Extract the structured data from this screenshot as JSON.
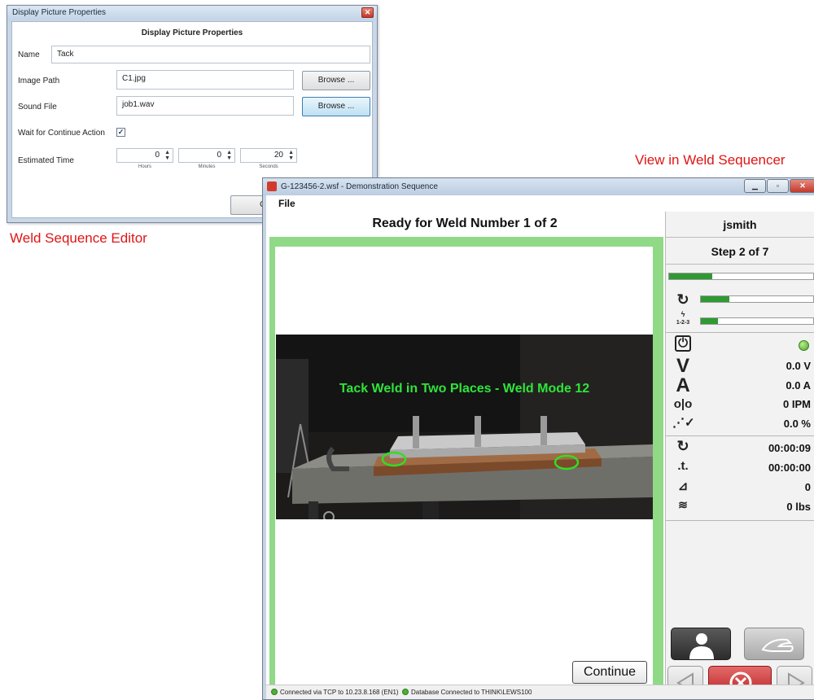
{
  "editor": {
    "window_title": "Display Picture Properties",
    "heading": "Display Picture Properties",
    "name_label": "Name",
    "name_value": "Tack",
    "image_path_label": "Image Path",
    "image_path_value": "C1.jpg",
    "browse_label": "Browse ...",
    "sound_file_label": "Sound File",
    "sound_file_value": "job1.wav",
    "wait_label": "Wait for Continue Action",
    "wait_checked": true,
    "estimated_time_label": "Estimated Time",
    "hours_value": "0",
    "minutes_value": "0",
    "seconds_value": "20",
    "hours_caption": "Hours",
    "minutes_caption": "Minutes",
    "seconds_caption": "Seconds",
    "ok_label": "O"
  },
  "captions": {
    "editor": "Weld Sequence Editor",
    "sequencer": "View in Weld Sequencer"
  },
  "sequencer": {
    "window_title": "G-123456-2.wsf - Demonstration Sequence",
    "menu_file": "File",
    "ready_text": "Ready for Weld Number 1 of 2",
    "photo_text": "Tack Weld in Two Places - Weld Mode 12",
    "continue_label": "Continue",
    "user": "jsmith",
    "step_text": "Step 2 of 7",
    "sequence_label": "1-2-3",
    "progress": {
      "step": 0.3,
      "time": 0.25,
      "sequence": 0.15
    },
    "voltage": "0.0 V",
    "current": "0.0 A",
    "wire_speed": "0 IPM",
    "percent": "0.0 %",
    "arc_time": "00:00:09",
    "total_time": "00:00:00",
    "weld_count": "0",
    "wire_weight": "0 lbs",
    "status_tcp": "Connected via TCP to 10.23.8.168 (EN1)",
    "status_db": "Database Connected to THINK\\LEWS100"
  },
  "colors": {
    "caption_red": "#e01414",
    "frame_green": "#8fd987",
    "photo_text_green": "#2fe43a",
    "progress_green": "#2f9a32",
    "stop_red": "#c62828"
  }
}
